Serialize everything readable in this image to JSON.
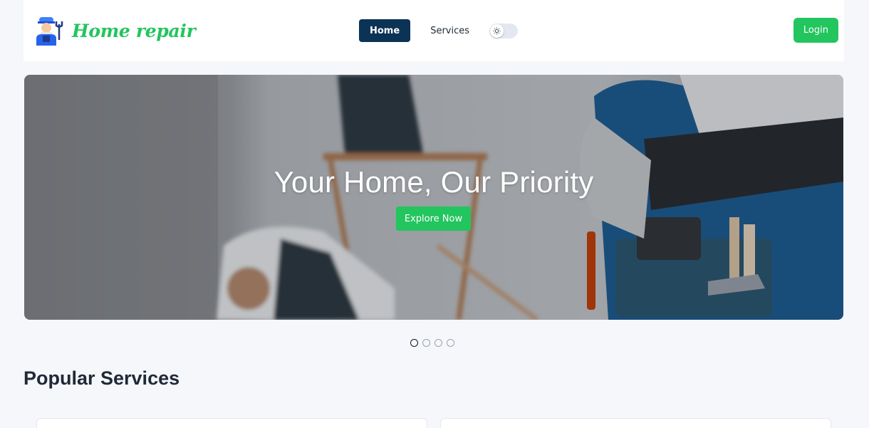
{
  "brand": {
    "name": "Home repair",
    "logo_icon": "repairman-icon"
  },
  "nav": {
    "home_label": "Home",
    "services_label": "Services",
    "theme_toggle_icon": "sun-icon"
  },
  "auth": {
    "login_label": "Login"
  },
  "hero": {
    "title": "Your Home, Our Priority",
    "cta_label": "Explore Now",
    "active_slide": 1,
    "slide_count": 4
  },
  "sections": {
    "popular_title": "Popular Services"
  },
  "colors": {
    "brand_green": "#22c55e",
    "nav_active": "#0a3356",
    "page_bg": "#f5f7fa"
  }
}
